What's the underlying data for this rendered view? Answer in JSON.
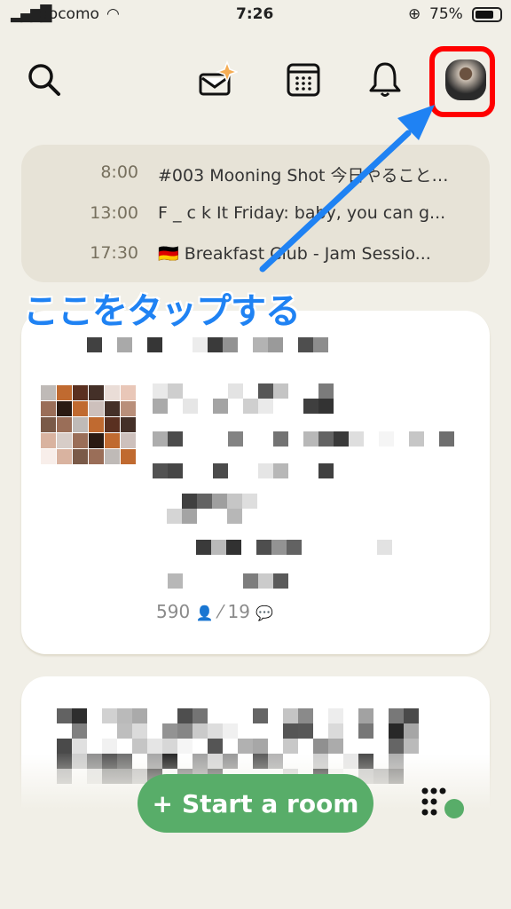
{
  "status_bar": {
    "carrier": "docomo",
    "time": "7:26",
    "battery": "75%"
  },
  "header": {
    "icons": [
      "search-icon",
      "invite-envelope-icon",
      "calendar-icon",
      "bell-icon",
      "profile-avatar"
    ]
  },
  "schedule": [
    {
      "time": "8:00",
      "title": "#003 Mooning Shot 今日やること…"
    },
    {
      "time": "13:00",
      "title": "F _ c k It Friday: baby, you can g..."
    },
    {
      "time": "17:30",
      "title": "🇩🇪 Breakfast Club - Jam Sessio..."
    }
  ],
  "annotation": {
    "text": "ここをタップする",
    "color": "#1f82f3",
    "highlight_color": "#ff0000"
  },
  "room_card": {
    "listeners": "590",
    "speakers": "19"
  },
  "bottom": {
    "start_room_label": "Start a room",
    "accent": "#58ad69"
  }
}
